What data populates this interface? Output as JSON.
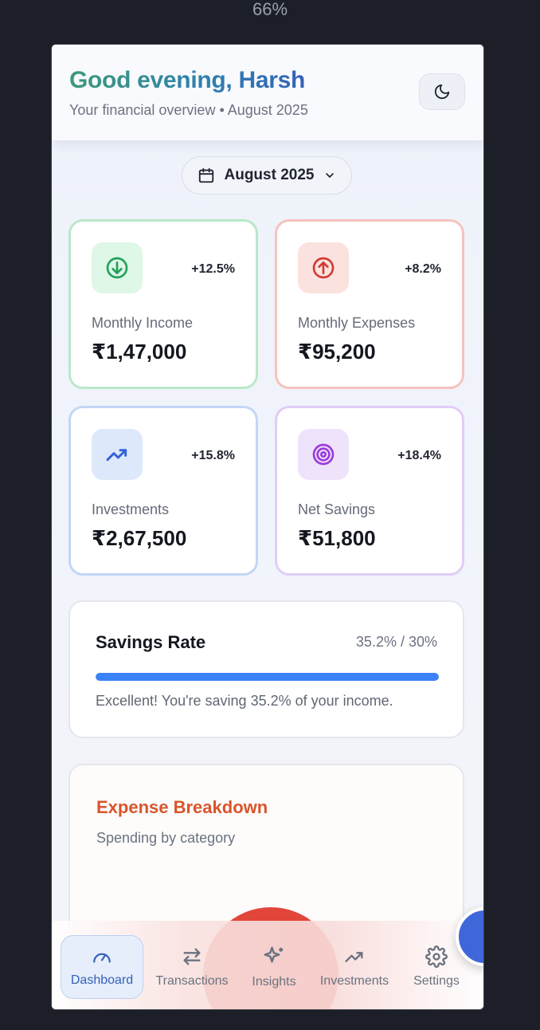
{
  "zoom": "66%",
  "header": {
    "greeting": "Good evening, Harsh",
    "subtitle": "Your financial overview • August 2025",
    "theme_toggle_icon": "moon-icon"
  },
  "month_picker": {
    "label": "August 2025",
    "icon": "calendar-icon"
  },
  "cards": [
    {
      "label": "Monthly Income",
      "value": "₹1,47,000",
      "change": "+12.5%",
      "icon": "arrow-down-circle-icon",
      "accent": "#22a15a",
      "border": "#b9e8c9",
      "icon_bg": "#def7e7"
    },
    {
      "label": "Monthly Expenses",
      "value": "₹95,200",
      "change": "+8.2%",
      "icon": "arrow-up-circle-icon",
      "accent": "#d23b34",
      "border": "#f5c3be",
      "icon_bg": "#fbe2df"
    },
    {
      "label": "Investments",
      "value": "₹2,67,500",
      "change": "+15.8%",
      "icon": "trending-up-icon",
      "accent": "#3361d8",
      "border": "#c2d6f6",
      "icon_bg": "#dee8fb"
    },
    {
      "label": "Net Savings",
      "value": "₹51,800",
      "change": "+18.4%",
      "icon": "target-icon",
      "accent": "#9b3bdc",
      "border": "#e1ccf7",
      "icon_bg": "#efe3fc"
    }
  ],
  "savings_rate": {
    "title": "Savings Rate",
    "ratio": "35.2% / 30%",
    "progress": 1.0,
    "message": "Excellent! You're saving 35.2% of your income."
  },
  "expense_breakdown": {
    "title": "Expense Breakdown",
    "subtitle": "Spending by category"
  },
  "nav": {
    "items": [
      {
        "label": "Dashboard",
        "icon": "gauge-icon",
        "active": true
      },
      {
        "label": "Transactions",
        "icon": "arrows-left-right-icon",
        "active": false
      },
      {
        "label": "Insights",
        "icon": "sparkles-icon",
        "active": false
      },
      {
        "label": "Investments",
        "icon": "trending-up-icon",
        "active": false
      },
      {
        "label": "Settings",
        "icon": "gear-icon",
        "active": false
      }
    ]
  },
  "colors": {
    "primary": "#3b82f6",
    "expense_title": "#d9552b"
  }
}
